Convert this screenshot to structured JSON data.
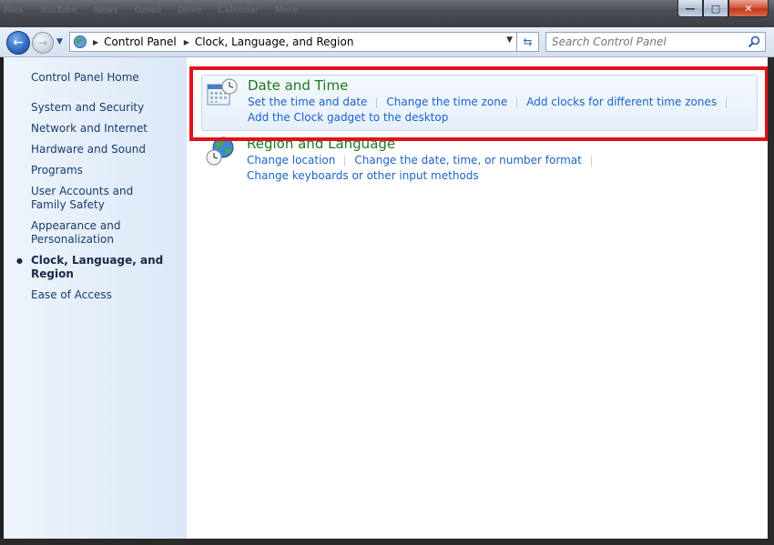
{
  "window": {
    "taskbar_ghost": [
      "Files",
      "YouTube",
      "News",
      "Gmail",
      "Drive",
      "Calendar",
      "More"
    ],
    "controls": {
      "minimize": "—",
      "maximize": "□",
      "close": "✕"
    }
  },
  "address_bar": {
    "breadcrumbs": [
      "Control Panel",
      "Clock, Language, and Region"
    ],
    "search_placeholder": "Search Control Panel"
  },
  "sidebar": {
    "home_label": "Control Panel Home",
    "items": [
      {
        "label": "System and Security",
        "active": false
      },
      {
        "label": "Network and Internet",
        "active": false
      },
      {
        "label": "Hardware and Sound",
        "active": false
      },
      {
        "label": "Programs",
        "active": false
      },
      {
        "label": "User Accounts and Family Safety",
        "active": false
      },
      {
        "label": "Appearance and Personalization",
        "active": false
      },
      {
        "label": "Clock, Language, and Region",
        "active": true
      },
      {
        "label": "Ease of Access",
        "active": false
      }
    ]
  },
  "main": {
    "date_time": {
      "title": "Date and Time",
      "links": [
        "Set the time and date",
        "Change the time zone",
        "Add clocks for different time zones",
        "Add the Clock gadget to the desktop"
      ]
    },
    "region_language": {
      "title": "Region and Language",
      "links": [
        "Change location",
        "Change the date, time, or number format",
        "Change keyboards or other input methods"
      ]
    }
  },
  "colors": {
    "highlight_box": "#e0121c",
    "category_title": "#1e7a1e",
    "link": "#1a63c7"
  }
}
